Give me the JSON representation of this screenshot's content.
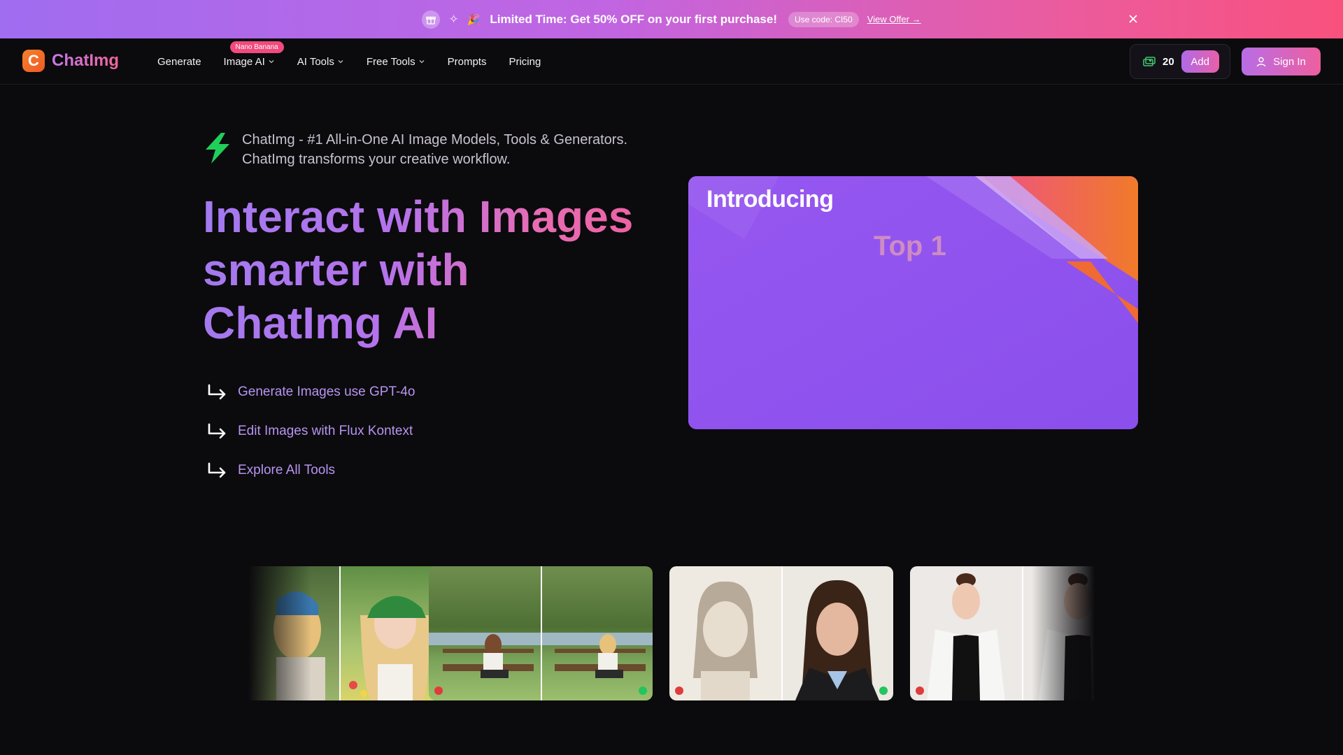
{
  "promo": {
    "title": "Limited Time: Get 50% OFF on your first purchase!",
    "party_emoji": "🎉",
    "code": "Use code: CI50",
    "offer_link": "View Offer →"
  },
  "nav": {
    "brand": "ChatImg",
    "logo_letter": "C",
    "items": [
      {
        "label": "Generate"
      },
      {
        "label": "Image AI",
        "badge": "Nano Banana"
      },
      {
        "label": "AI Tools"
      },
      {
        "label": "Free Tools"
      },
      {
        "label": "Prompts"
      },
      {
        "label": "Pricing"
      }
    ],
    "credits": "20",
    "add_label": "Add",
    "signin_label": "Sign In"
  },
  "hero": {
    "tagline": "ChatImg - #1 All-in-One AI Image Models, Tools & Generators. ChatImg transforms your creative workflow.",
    "headline_line1": "Interact with Images",
    "headline_line2": "smarter with",
    "headline_line3": "ChatImg AI",
    "links": [
      "Generate Images use GPT-4o",
      "Edit Images with Flux Kontext",
      "Explore All Tools"
    ]
  },
  "video": {
    "intro": "Introducing",
    "top": "Top 1"
  },
  "colors": {
    "accent_purple": "#b06ae8",
    "accent_pink": "#ec5b9c",
    "status_red": "#e03b3b",
    "status_green": "#22c55e"
  }
}
